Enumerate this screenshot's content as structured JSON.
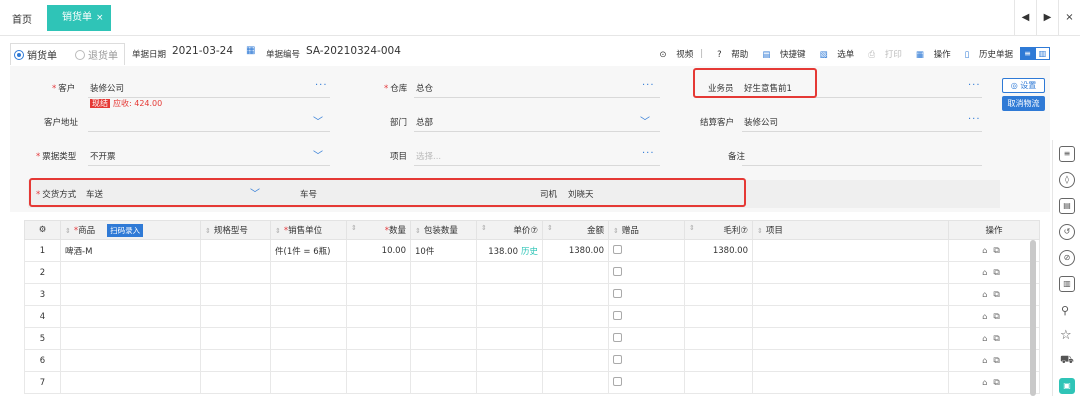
{
  "tabs": {
    "home": "首页",
    "active": "销货单",
    "close": "×"
  },
  "tab_controls": [
    "◀",
    "▶",
    "×"
  ],
  "toolbar": {
    "radio_sale": "销货单",
    "radio_return": "退货单",
    "date_label": "单据日期",
    "date_value": "2021-03-24",
    "no_label": "单据编号",
    "no_value": "SA-20210324-004",
    "video": "视频",
    "help": "帮助",
    "shortcut": "快捷键",
    "select": "选单",
    "print": "打印",
    "operate": "操作",
    "history": "历史单据"
  },
  "form": {
    "customer_label": "客户",
    "customer_value": "装修公司",
    "settled_tag": "现结",
    "receivable": "应收: 424.00",
    "warehouse_label": "仓库",
    "warehouse_value": "总仓",
    "salesman_label": "业务员",
    "salesman_value": "好生意售前1",
    "settings_btn": "◎ 设置",
    "cancel_logistics_btn": "取消物流",
    "address_label": "客户地址",
    "dept_label": "部门",
    "dept_value": "总部",
    "settle_customer_label": "结算客户",
    "settle_customer_value": "装修公司",
    "invoice_label": "票据类型",
    "invoice_value": "不开票",
    "project_label": "项目",
    "project_placeholder": "选择...",
    "remark_label": "备注",
    "delivery_label": "交货方式",
    "delivery_value": "车送",
    "plate_label": "车号",
    "driver_label": "司机",
    "driver_value": "刘晓天"
  },
  "grid": {
    "headers": {
      "product": "商品",
      "scan": "扫码录入",
      "spec": "规格型号",
      "unit": "销售单位",
      "qty": "数量",
      "pack": "包装数量",
      "price": "单价⑦",
      "amount": "金额",
      "gift": "赠品",
      "profit": "毛利⑦",
      "project": "项目",
      "ops": "操作"
    },
    "rows": [
      {
        "no": "1",
        "product": "啤酒-M",
        "spec": "",
        "unit": "件(1件 = 6瓶)",
        "qty": "10.00",
        "pack": "10件",
        "price": "138.00",
        "hist": "历史",
        "amount": "1380.00",
        "profit": "1380.00"
      },
      {
        "no": "2",
        "product": "",
        "spec": "",
        "unit": "",
        "qty": "",
        "pack": "",
        "price": "",
        "hist": "",
        "amount": "",
        "profit": ""
      },
      {
        "no": "3",
        "product": "",
        "spec": "",
        "unit": "",
        "qty": "",
        "pack": "",
        "price": "",
        "hist": "",
        "amount": "",
        "profit": ""
      },
      {
        "no": "4",
        "product": "",
        "spec": "",
        "unit": "",
        "qty": "",
        "pack": "",
        "price": "",
        "hist": "",
        "amount": "",
        "profit": ""
      },
      {
        "no": "5",
        "product": "",
        "spec": "",
        "unit": "",
        "qty": "",
        "pack": "",
        "price": "",
        "hist": "",
        "amount": "",
        "profit": ""
      },
      {
        "no": "6",
        "product": "",
        "spec": "",
        "unit": "",
        "qty": "",
        "pack": "",
        "price": "",
        "hist": "",
        "amount": "",
        "profit": ""
      },
      {
        "no": "7",
        "product": "",
        "spec": "",
        "unit": "",
        "qty": "",
        "pack": "",
        "price": "",
        "hist": "",
        "amount": "",
        "profit": ""
      }
    ]
  },
  "sidebar_icons": [
    "doc-icon",
    "shield-icon",
    "warehouse-icon",
    "return-icon",
    "cancel-icon",
    "voucher-icon",
    "link-icon",
    "star-icon",
    "truck-icon",
    "image-icon"
  ],
  "colors": {
    "accent": "#2fc4b7",
    "primary": "#2f7ad6",
    "highlight": "#e53935"
  }
}
